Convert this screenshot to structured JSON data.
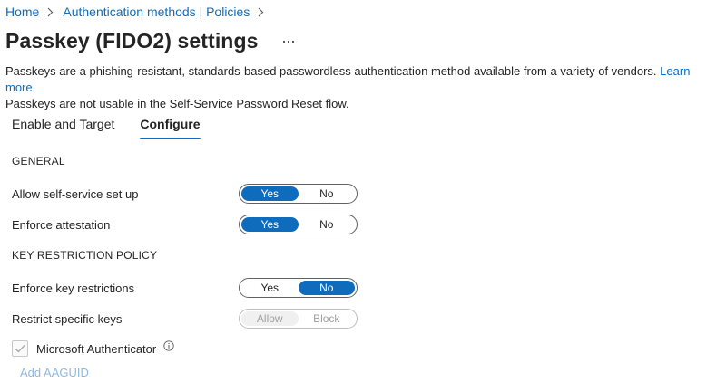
{
  "breadcrumb": {
    "items": [
      "Home",
      "Authentication methods | Policies"
    ]
  },
  "header": {
    "title": "Passkey (FIDO2) settings"
  },
  "description": {
    "line1": "Passkeys are a phishing-resistant, standards-based passwordless authentication method available from a variety of vendors.",
    "learn_more": "Learn more.",
    "line2": "Passkeys are not usable in the Self-Service Password Reset flow."
  },
  "tabs": {
    "items": [
      {
        "label": "Enable and Target",
        "active": false
      },
      {
        "label": "Configure",
        "active": true
      }
    ]
  },
  "general": {
    "heading": "GENERAL",
    "self_service": {
      "label": "Allow self-service set up",
      "yes": "Yes",
      "no": "No",
      "selected": "Yes"
    },
    "attestation": {
      "label": "Enforce attestation",
      "yes": "Yes",
      "no": "No",
      "selected": "Yes"
    }
  },
  "key_restriction": {
    "heading": "KEY RESTRICTION POLICY",
    "enforce": {
      "label": "Enforce key restrictions",
      "yes": "Yes",
      "no": "No",
      "selected": "No"
    },
    "restrict": {
      "label": "Restrict specific keys",
      "allow": "Allow",
      "block": "Block",
      "selected": "Allow",
      "disabled": true
    },
    "authenticator": {
      "label": "Microsoft Authenticator",
      "checked": true,
      "disabled": true
    },
    "add_link": "Add AAGUID"
  },
  "colors": {
    "accent": "#0f6cbd",
    "text": "#242424",
    "disabled_text": "#a0a0a0",
    "disabled_link": "#8fb8e0"
  }
}
